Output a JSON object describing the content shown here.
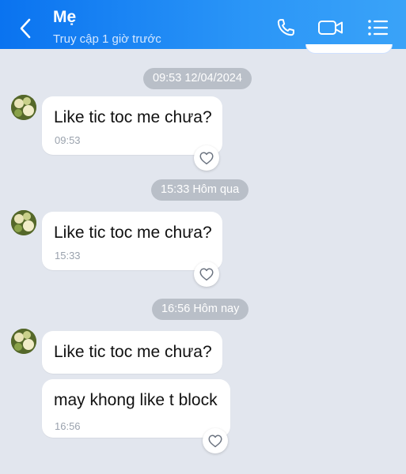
{
  "header": {
    "contact_name": "Mẹ",
    "last_seen": "Truy cập 1 giờ trước",
    "icons": [
      "back-icon",
      "phone-icon",
      "video-call-icon",
      "menu-icon"
    ]
  },
  "colors": {
    "header_accent": "#0a73f0",
    "chat_background": "#e2e6ee",
    "bubble": "#ffffff",
    "time_pill": "#b9bfc8"
  },
  "conversation": [
    {
      "separator": "09:53 12/04/2024",
      "messages": [
        {
          "text": "Like tic toc me chưa?",
          "time": "09:53"
        }
      ]
    },
    {
      "separator": "15:33 Hôm qua",
      "messages": [
        {
          "text": "Like tic toc me chưa?",
          "time": "15:33"
        }
      ]
    },
    {
      "separator": "16:56 Hôm nay",
      "messages": [
        {
          "text": "Like tic toc me chưa?"
        },
        {
          "text": "may khong like t block",
          "time": "16:56"
        }
      ]
    }
  ]
}
